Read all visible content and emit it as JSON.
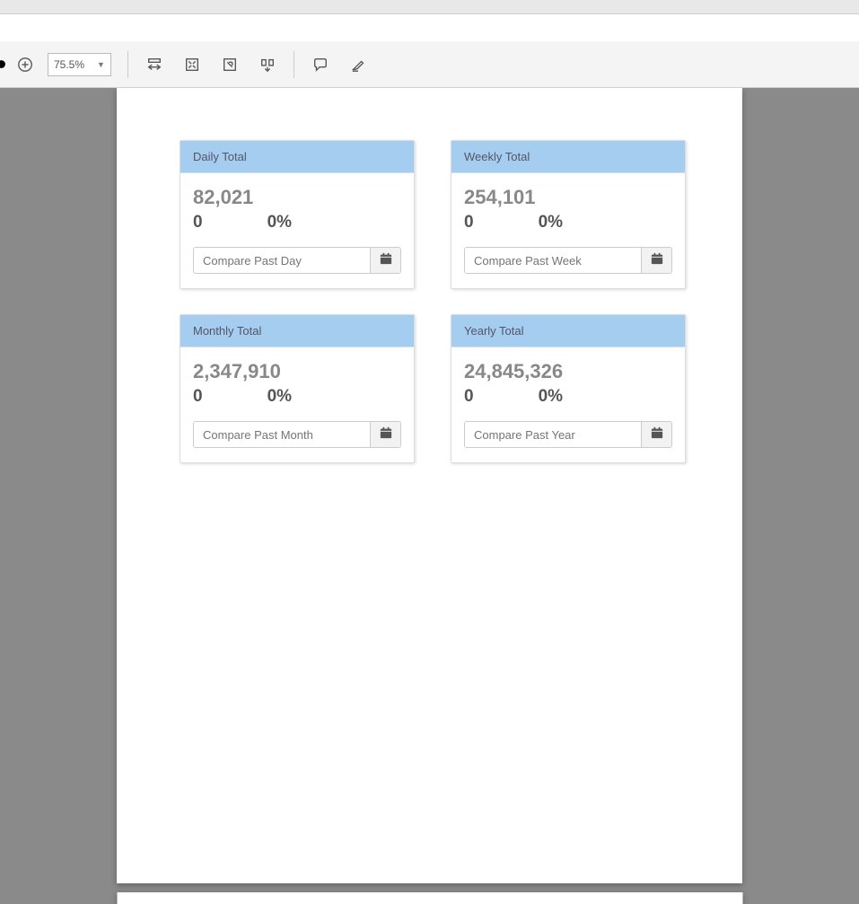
{
  "toolbar": {
    "zoom": "75.5%"
  },
  "cards": {
    "daily": {
      "title": "Daily Total",
      "value": "82,021",
      "diff": "0",
      "pct": "0%",
      "compare_placeholder": "Compare Past Day"
    },
    "weekly": {
      "title": "Weekly Total",
      "value": "254,101",
      "diff": "0",
      "pct": "0%",
      "compare_placeholder": "Compare Past Week"
    },
    "monthly": {
      "title": "Monthly Total",
      "value": "2,347,910",
      "diff": "0",
      "pct": "0%",
      "compare_placeholder": "Compare Past Month"
    },
    "yearly": {
      "title": "Yearly Total",
      "value": "24,845,326",
      "diff": "0",
      "pct": "0%",
      "compare_placeholder": "Compare Past Year"
    }
  }
}
